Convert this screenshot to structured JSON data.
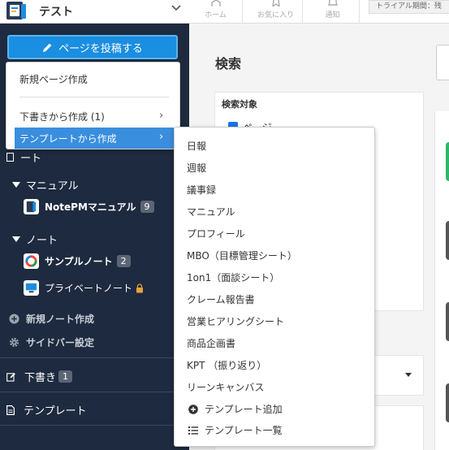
{
  "workspace": {
    "name": "テスト"
  },
  "topbar": {
    "home_label": "ホーム",
    "favorites_label": "お気に入り",
    "notifications_label": "通知",
    "trial_text": "トライアル期間：残"
  },
  "sidebar": {
    "post_button_label": "ページを投稿する",
    "partial_label": "ート",
    "manual_section": "マニュアル",
    "manual_note": {
      "name": "NotePMマニュアル",
      "count": "9"
    },
    "notes_section": "ノート",
    "sample_note": {
      "name": "サンプルノート",
      "count": "2"
    },
    "private_note": {
      "name": "プライベートノート"
    },
    "new_note_label": "新規ノート作成",
    "sidebar_settings_label": "サイドバー設定",
    "drafts": {
      "label": "下書き",
      "count": "1"
    },
    "templates_label": "テンプレート"
  },
  "main": {
    "search_title": "検索",
    "search_target_label": "検索対象",
    "search_target_option": "ページ"
  },
  "post_menu": {
    "new_page": "新規ページ作成",
    "from_draft": "下書きから作成 (1)",
    "from_template": "テンプレートから作成",
    "arrow": "›"
  },
  "template_menu": {
    "items": [
      "日報",
      "週報",
      "議事録",
      "マニュアル",
      "プロフィール",
      "MBO（目標管理シート）",
      "1on1（面談シート）",
      "クレーム報告書",
      "営業ヒアリングシート",
      "商品企画書",
      "KPT （振り返り）",
      "リーンキャンバス"
    ],
    "add_template": "テンプレート追加",
    "list_templates": "テンプレート一覧"
  },
  "colors": {
    "sidebar_bg": "#1e2a3f",
    "accent": "#1a8ee0",
    "menu_highlight": "#3a8ede",
    "lock": "#e8a33c"
  },
  "icons": {
    "post": "pencil-icon",
    "lock": "lock-icon",
    "plus": "plus-circle-icon",
    "gear": "gear-icon",
    "drafts": "edit-icon",
    "templates": "document-icon",
    "list": "list-icon"
  }
}
